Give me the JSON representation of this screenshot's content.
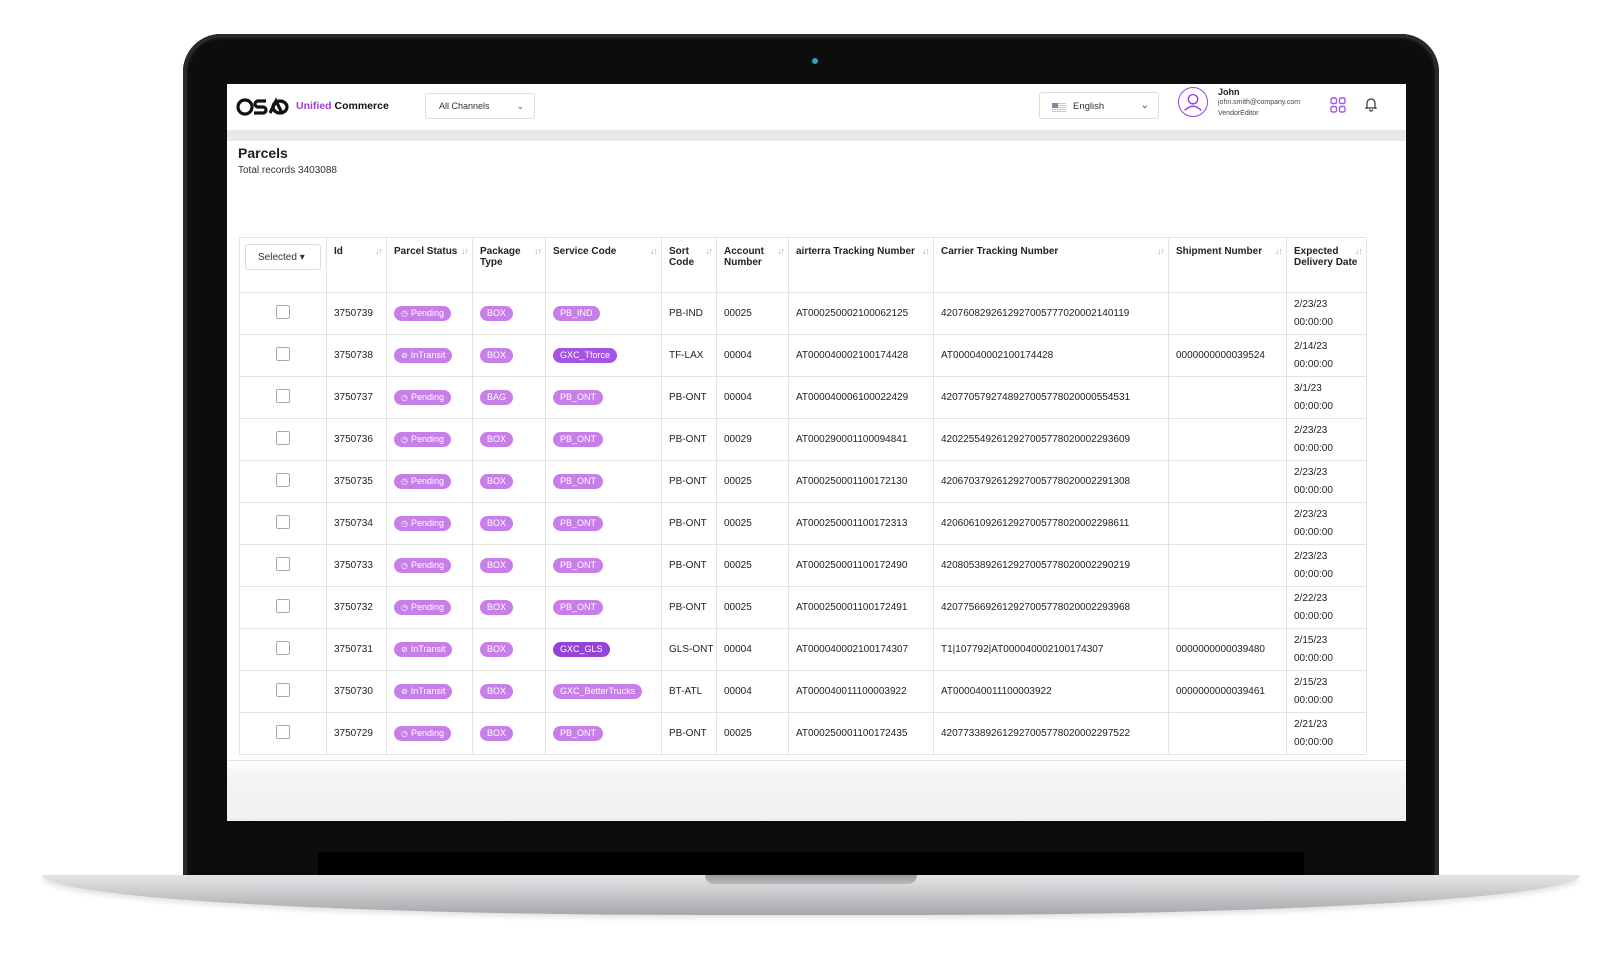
{
  "header": {
    "brand_accent": "Unified",
    "brand_rest": "Commerce",
    "channel_select": "All Channels",
    "language": "English",
    "user": {
      "name": "John",
      "email": "john.smith@company.com",
      "role": "VendorEditor"
    }
  },
  "page": {
    "title": "Parcels",
    "total_records": "Total records 3403088"
  },
  "table": {
    "select_label": "Selected",
    "columns": [
      "Id",
      "Parcel Status",
      "Package Type",
      "Service Code",
      "Sort Code",
      "Account Number",
      "airterra Tracking Number",
      "Carrier Tracking Number",
      "Shipment Number",
      "Expected Delivery Date"
    ],
    "rows": [
      {
        "id": "3750739",
        "status": "Pending",
        "pkg": "BOX",
        "svc": "PB_IND",
        "sort": "PB-IND",
        "acct": "00025",
        "airterra": "AT000250002100062125",
        "carrier": "420760829261292700577702000214011​9",
        "ship": "",
        "date": "2/23/23",
        "time": "00:00:00"
      },
      {
        "id": "3750738",
        "status": "InTransit",
        "pkg": "BOX",
        "svc": "GXC_Tforce",
        "sort": "TF-LAX",
        "acct": "00004",
        "airterra": "AT000040002100174428",
        "carrier": "AT000040002100174428",
        "ship": "0000000000039524",
        "date": "2/14/23",
        "time": "00:00:00"
      },
      {
        "id": "3750737",
        "status": "Pending",
        "pkg": "BAG",
        "svc": "PB_ONT",
        "sort": "PB-ONT",
        "acct": "00004",
        "airterra": "AT000040006100022429",
        "carrier": "42077057927489270057780200005545​31",
        "ship": "",
        "date": "3/1/23",
        "time": "00:00:00"
      },
      {
        "id": "3750736",
        "status": "Pending",
        "pkg": "BOX",
        "svc": "PB_ONT",
        "sort": "PB-ONT",
        "acct": "00029",
        "airterra": "AT000290001100094841",
        "carrier": "4202255492612927005778020002293609",
        "ship": "",
        "date": "2/23/23",
        "time": "00:00:00"
      },
      {
        "id": "3750735",
        "status": "Pending",
        "pkg": "BOX",
        "svc": "PB_ONT",
        "sort": "PB-ONT",
        "acct": "00025",
        "airterra": "AT000250001100172130",
        "carrier": "4206703792612927005778020002291308",
        "ship": "",
        "date": "2/23/23",
        "time": "00:00:00"
      },
      {
        "id": "3750734",
        "status": "Pending",
        "pkg": "BOX",
        "svc": "PB_ONT",
        "sort": "PB-ONT",
        "acct": "00025",
        "airterra": "AT000250001100172313",
        "carrier": "4206061092612927005778020002298611",
        "ship": "",
        "date": "2/23/23",
        "time": "00:00:00"
      },
      {
        "id": "3750733",
        "status": "Pending",
        "pkg": "BOX",
        "svc": "PB_ONT",
        "sort": "PB-ONT",
        "acct": "00025",
        "airterra": "AT000250001100172490",
        "carrier": "4208053892612927005778020002290219",
        "ship": "",
        "date": "2/23/23",
        "time": "00:00:00"
      },
      {
        "id": "3750732",
        "status": "Pending",
        "pkg": "BOX",
        "svc": "PB_ONT",
        "sort": "PB-ONT",
        "acct": "00025",
        "airterra": "AT000250001100172491",
        "carrier": "4207756692612927005778020002293968",
        "ship": "",
        "date": "2/22/23",
        "time": "00:00:00"
      },
      {
        "id": "3750731",
        "status": "InTransit",
        "pkg": "BOX",
        "svc": "GXC_GLS",
        "sort": "GLS-ONT",
        "acct": "00004",
        "airterra": "AT000040002100174307",
        "carrier": "T1|107792|AT000040002100174307",
        "ship": "0000000000039480",
        "date": "2/15/23",
        "time": "00:00:00"
      },
      {
        "id": "3750730",
        "status": "InTransit",
        "pkg": "BOX",
        "svc": "GXC_BetterTrucks",
        "sort": "BT-ATL",
        "acct": "00004",
        "airterra": "AT000040011100003922",
        "carrier": "AT000040011100003922",
        "ship": "0000000000039461",
        "date": "2/15/23",
        "time": "00:00:00"
      },
      {
        "id": "3750729",
        "status": "Pending",
        "pkg": "BOX",
        "svc": "PB_ONT",
        "sort": "PB-ONT",
        "acct": "00025",
        "airterra": "AT000250001100172435",
        "carrier": "4207733892612927005778020002297522",
        "ship": "",
        "date": "2/21/23",
        "time": "00:00:00"
      }
    ]
  },
  "colors": {
    "accent": "#9b3fe0",
    "pill": "#c77ee9",
    "pill_dark": "#9443d8"
  },
  "icons": [
    "logo-icon",
    "chevron-down-icon",
    "flag-icon",
    "user-avatar-icon",
    "apps-grid-icon",
    "bell-icon",
    "sort-icon",
    "clock-icon",
    "ban-icon"
  ]
}
